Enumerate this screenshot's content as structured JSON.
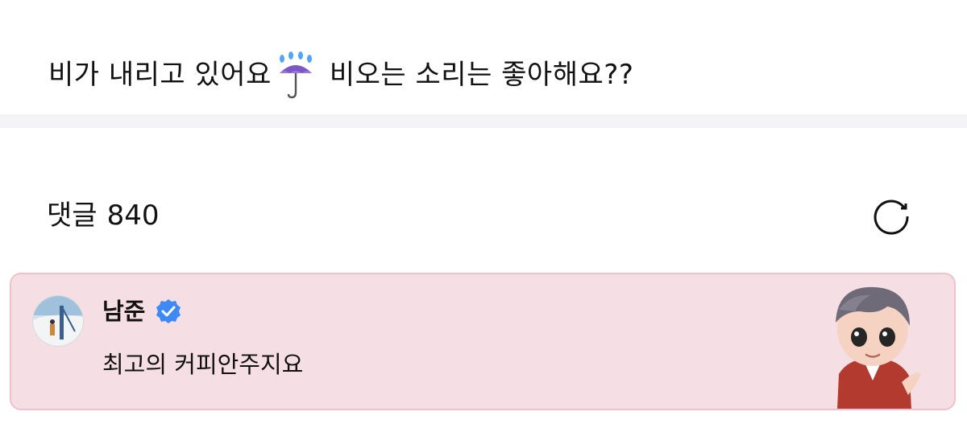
{
  "post": {
    "text_part1": "비가 내리고 있어요",
    "emoji_icon": "umbrella-with-rain-icon",
    "text_part2": "비오는 소리는 좋아해요??"
  },
  "comments": {
    "label": "댓글",
    "count": "840",
    "refresh_icon": "refresh-icon"
  },
  "comment": {
    "author": "남준",
    "verified_icon": "verified-badge-icon",
    "text": "최고의 커피안주지요",
    "background_color": "#f6dfe4",
    "border_color": "#efc1cb"
  },
  "colors": {
    "text": "#111111",
    "divider": "#f4f4f8",
    "verified": "#3d8af5"
  }
}
